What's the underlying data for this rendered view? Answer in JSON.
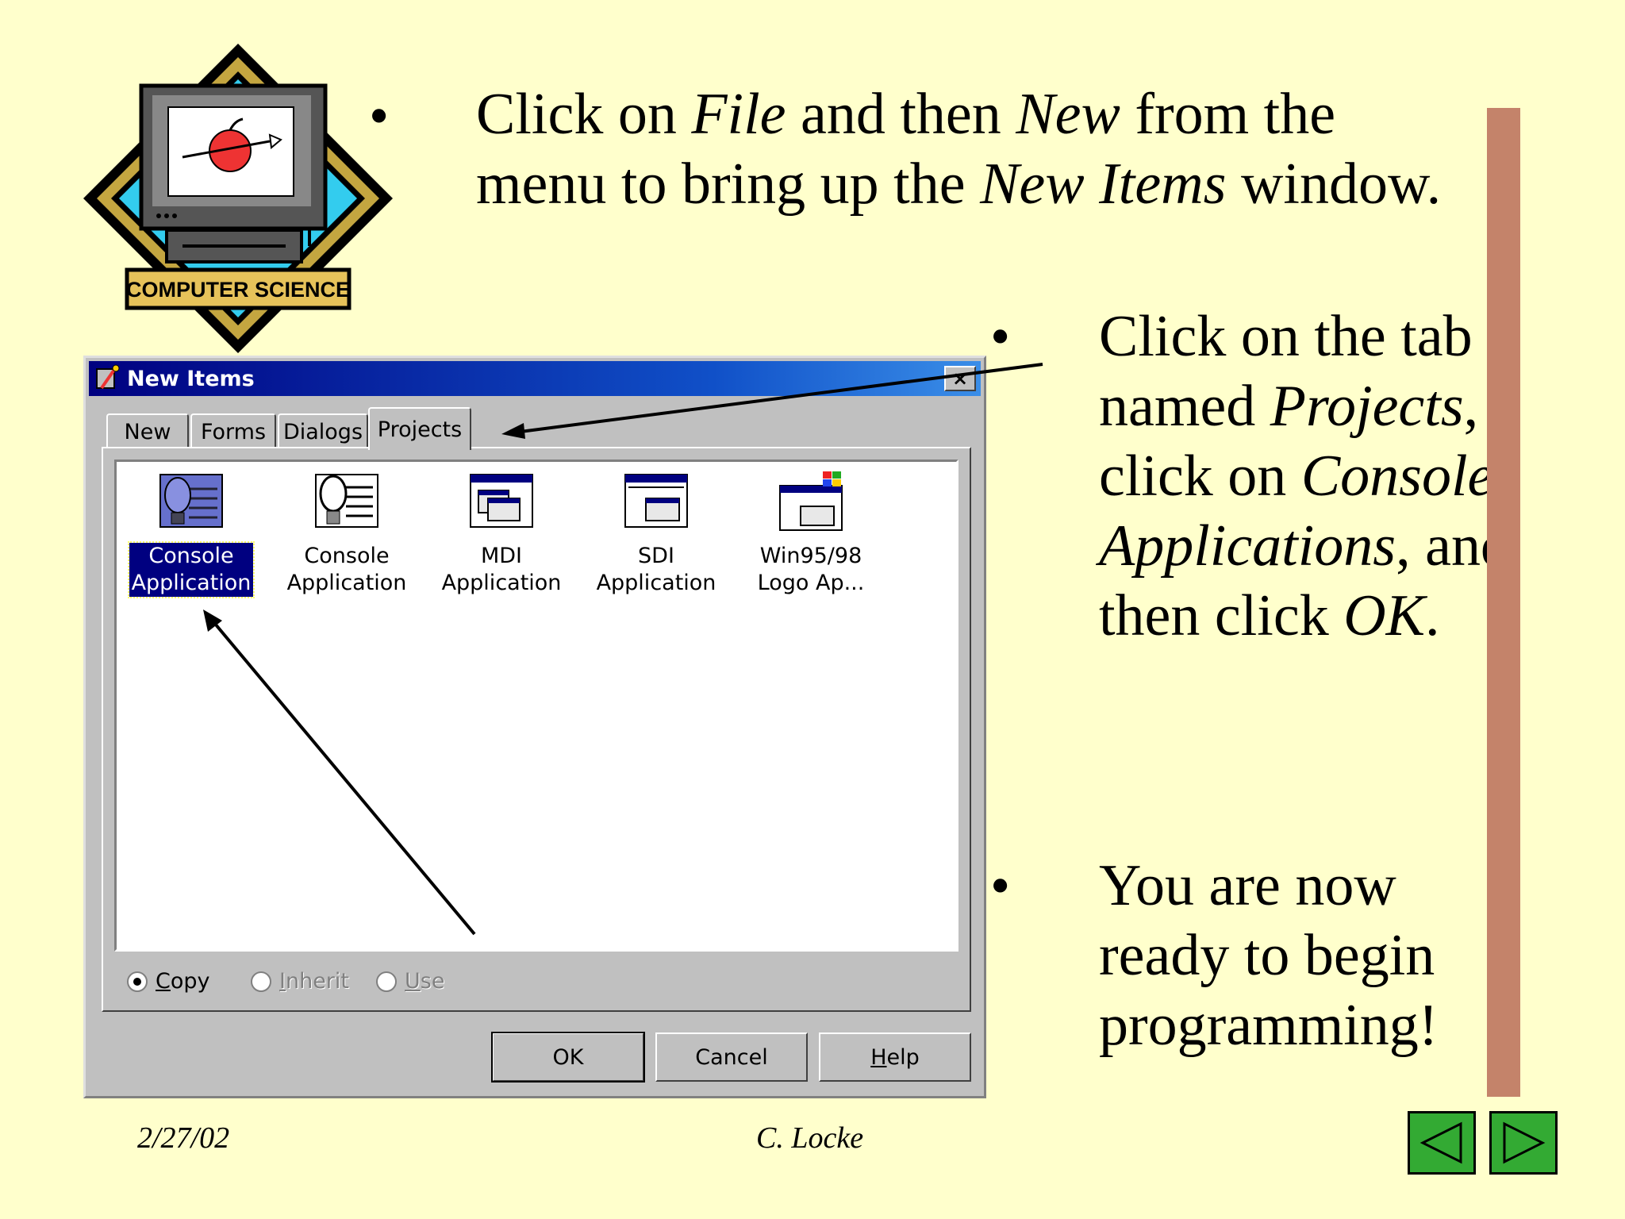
{
  "logo": {
    "label": "COMPUTER SCIENCE"
  },
  "instructions": {
    "bullet": "•",
    "p1": [
      "Click on ",
      "File",
      " and then ",
      "New",
      " from the menu to bring up the ",
      "New Items",
      " window."
    ],
    "p2": [
      "Click on the tab named ",
      "Projects",
      ", click on ",
      "Console Applications",
      ", and then click ",
      "OK",
      "."
    ],
    "p3": "You are now ready to begin programming!"
  },
  "dialog": {
    "title": "New Items",
    "close": "×",
    "tabs": [
      "New",
      "Forms",
      "Dialogs",
      "Projects"
    ],
    "items": [
      {
        "line1": "Console",
        "line2": "Application"
      },
      {
        "line1": "Console",
        "line2": "Application"
      },
      {
        "line1": "MDI",
        "line2": "Application"
      },
      {
        "line1": "SDI",
        "line2": "Application"
      },
      {
        "line1": "Win95/98",
        "line2": "Logo Ap..."
      }
    ],
    "radios": {
      "copy": {
        "first": "C",
        "rest": "opy"
      },
      "inherit": {
        "first": "I",
        "rest": "nherit"
      },
      "use": {
        "first": "U",
        "rest": "se"
      }
    },
    "buttons": {
      "ok": "OK",
      "cancel": "Cancel",
      "help_first": "H",
      "help_rest": "elp"
    }
  },
  "footer": {
    "date": "2/27/02",
    "author": "C. Locke"
  },
  "colors": {
    "background": "#ffffcc",
    "sidebar": "#c4836a",
    "nav": "#33aa33",
    "titlebar": "#000080"
  }
}
